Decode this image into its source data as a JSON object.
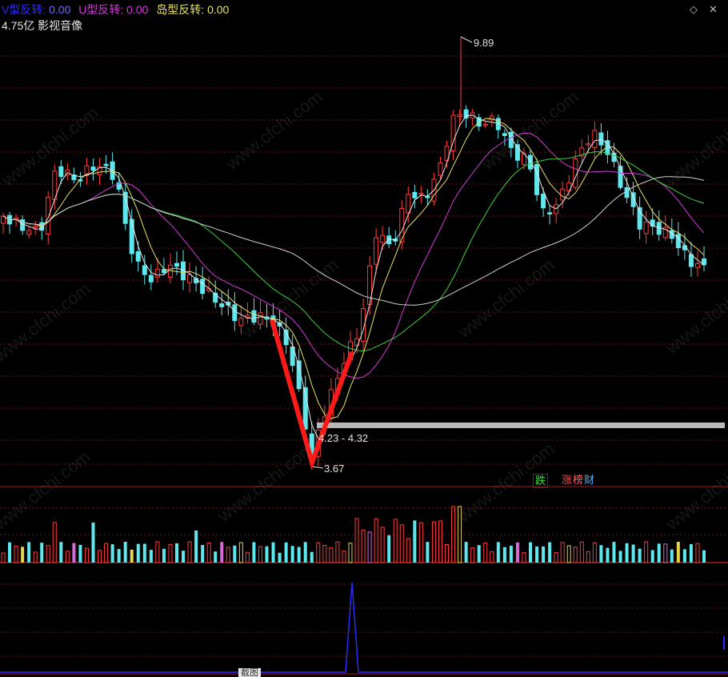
{
  "header": {
    "indicators": [
      {
        "label": "V型反转:",
        "value": "0.00",
        "label_color": "#2a2cff",
        "value_color": "#6a6cff"
      },
      {
        "label": "U型反转:",
        "value": "0.00",
        "label_color": "#d23cd6",
        "value_color": "#d23cd6"
      },
      {
        "label": "岛型反转:",
        "value": "0.00",
        "label_color": "#e8e56a",
        "value_color": "#e8e56a"
      }
    ],
    "subtitle": "4.75亿 影视音像"
  },
  "price_annotations": {
    "high_label": "9.89",
    "low_label": "3.67",
    "zone_label": "4.23 - 4.32"
  },
  "markers": {
    "fall_label": "跌",
    "tags": [
      "涨",
      "榜",
      "财"
    ]
  },
  "watermark": "www.cfchi.com",
  "snip_label": "截图",
  "colors": {
    "up_candle": "#ff3b3b",
    "down_candle": "#5ee8ee",
    "ma5": "#e6e6e6",
    "ma10": "#e6e36a",
    "ma20": "#d23cd6",
    "ma30": "#3fcf3f",
    "ma60": "#cfcfcf",
    "v_mark": "#ff1a1a",
    "signal": "#2a2aff",
    "grid": "#7a1010"
  },
  "icons": [
    "diamond-icon",
    "close-icon"
  ]
}
